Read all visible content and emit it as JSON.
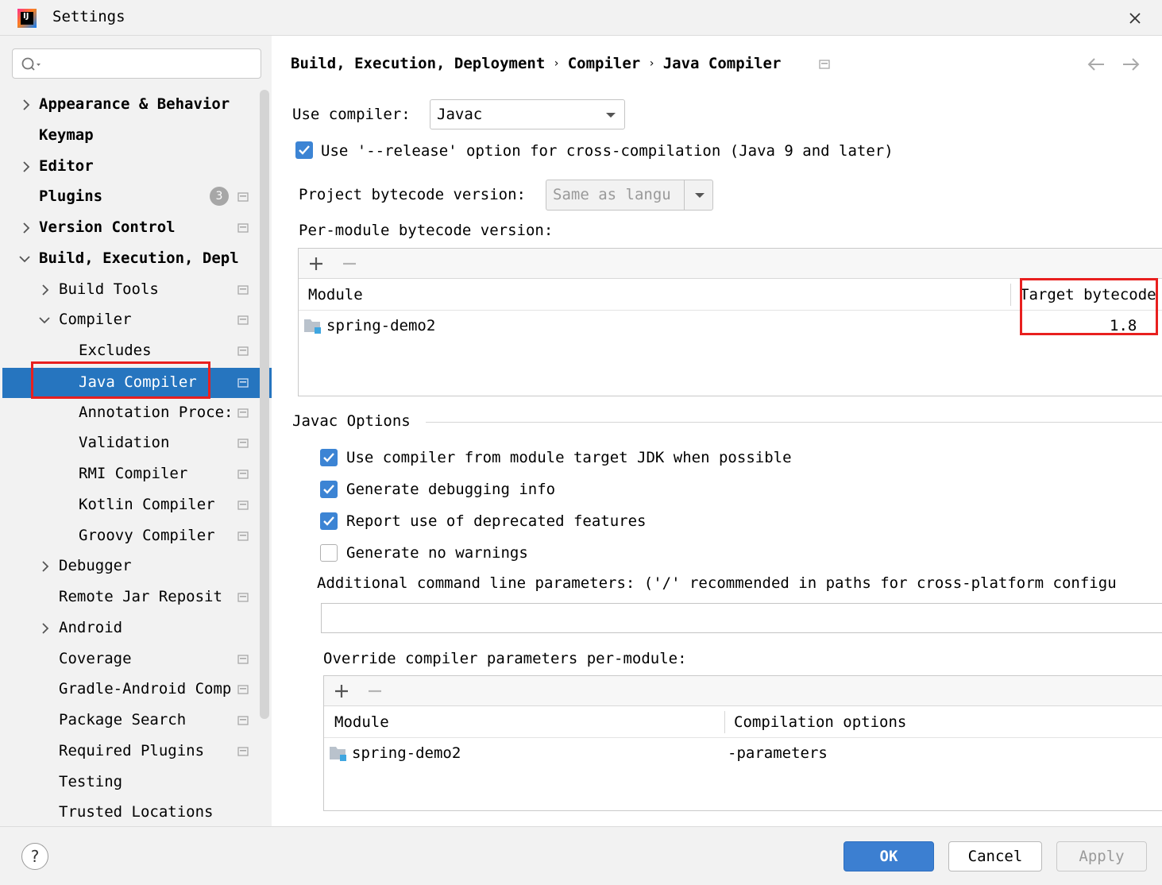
{
  "window": {
    "title": "Settings",
    "logo_text": "IJ"
  },
  "sidebar": {
    "search_placeholder": "",
    "items": [
      {
        "label": "Appearance & Behavior",
        "chevron": "right"
      },
      {
        "label": "Keymap"
      },
      {
        "label": "Editor",
        "chevron": "right"
      },
      {
        "label": "Plugins",
        "badge": "3"
      },
      {
        "label": "Version Control",
        "chevron": "right"
      },
      {
        "label": "Build, Execution, Depl",
        "chevron": "down"
      },
      {
        "label": "Build Tools",
        "chevron": "right"
      },
      {
        "label": "Compiler",
        "chevron": "down"
      },
      {
        "label": "Excludes"
      },
      {
        "label": "Java Compiler",
        "selected": true
      },
      {
        "label": "Annotation Proce:"
      },
      {
        "label": "Validation"
      },
      {
        "label": "RMI Compiler"
      },
      {
        "label": "Kotlin Compiler"
      },
      {
        "label": "Groovy Compiler"
      },
      {
        "label": "Debugger",
        "chevron": "right"
      },
      {
        "label": "Remote Jar Reposit"
      },
      {
        "label": "Android",
        "chevron": "right"
      },
      {
        "label": "Coverage"
      },
      {
        "label": "Gradle-Android Comp"
      },
      {
        "label": "Package Search"
      },
      {
        "label": "Required Plugins"
      },
      {
        "label": "Testing"
      },
      {
        "label": "Trusted Locations"
      }
    ]
  },
  "breadcrumb": {
    "part1": "Build, Execution, Deployment",
    "part2": "Compiler",
    "part3": "Java Compiler",
    "separator": "›"
  },
  "compiler": {
    "use_compiler_label": "Use compiler:",
    "use_compiler_value": "Javac",
    "release_option_label": "Use '--release' option for cross-compilation (Java 9 and later)",
    "release_option_checked": true,
    "project_bytecode_label": "Project bytecode version:",
    "project_bytecode_value": "Same as langu",
    "per_module_label": "Per-module bytecode version:",
    "per_module_table": {
      "headers": [
        "Module",
        "Target bytecode"
      ],
      "rows": [
        {
          "module": "spring-demo2",
          "target": "1.8"
        }
      ]
    }
  },
  "javac": {
    "section_title": "Javac Options",
    "options": [
      {
        "label": "Use compiler from module target JDK when possible",
        "checked": true
      },
      {
        "label": "Generate debugging info",
        "checked": true
      },
      {
        "label": "Report use of deprecated features",
        "checked": true
      },
      {
        "label": "Generate no warnings",
        "checked": false
      }
    ],
    "additional_params_label": "Additional command line parameters:  ('/' recommended in paths for cross-platform configu",
    "additional_params_value": "",
    "override_label": "Override compiler parameters per-module:",
    "override_table": {
      "headers": [
        "Module",
        "Compilation options"
      ],
      "rows": [
        {
          "module": "spring-demo2",
          "options": "-parameters"
        }
      ]
    }
  },
  "footer": {
    "help": "?",
    "ok": "OK",
    "cancel": "Cancel",
    "apply": "Apply"
  },
  "colors": {
    "selection": "#2675bf",
    "checkbox_on": "#3c84d4",
    "primary_button": "#3c7fd1",
    "annotation_red": "#e8201f"
  }
}
